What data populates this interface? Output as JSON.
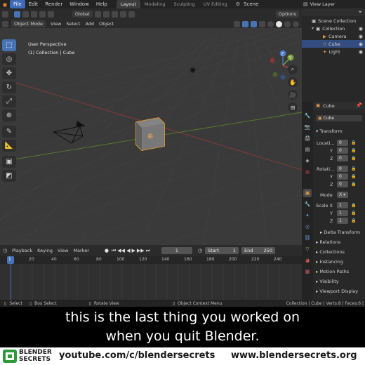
{
  "topbar": {
    "menu": [
      "File",
      "Edit",
      "Render",
      "Window",
      "Help"
    ],
    "workspaces": [
      "Layout",
      "Modeling",
      "Sculpting",
      "UV Editing"
    ],
    "scene_label": "Scene",
    "view_layer_label": "View Layer"
  },
  "viewport": {
    "header": {
      "orientation": "Global",
      "options": "Options",
      "mode": "Object Mode",
      "menus": [
        "View",
        "Select",
        "Add",
        "Object"
      ]
    },
    "perspective_label": "User Perspective",
    "collection_label": "(1) Collection | Cube",
    "gizmo": {
      "x": "X",
      "y": "Y",
      "z": "Z"
    }
  },
  "outliner": {
    "scene_collection": "Scene Collection",
    "collection": "Collection",
    "items": [
      "Camera",
      "Cube",
      "Light"
    ],
    "selected": "Cube"
  },
  "properties": {
    "object_name": "Cube",
    "object_name_field": "Cube",
    "transform_label": "Transform",
    "location_label": "Locati...",
    "location": [
      "0",
      "0",
      "0"
    ],
    "rotation_label": "Rotati...",
    "rotation": [
      "0",
      "0",
      "0"
    ],
    "mode_label": "Mode",
    "mode_value": "X",
    "scale_label": "Scale X",
    "scale": [
      "1",
      "1",
      "1"
    ],
    "axis_y": "Y",
    "axis_z": "Z",
    "sections": [
      "Delta Transform",
      "Relations",
      "Collections",
      "Instancing",
      "Motion Paths",
      "Visibility",
      "Viewport Display"
    ]
  },
  "timeline": {
    "menus": [
      "Playback",
      "Keying",
      "View",
      "Marker"
    ],
    "current_frame": "1",
    "start_label": "Start",
    "start_value": "1",
    "end_label": "End",
    "end_value": "250",
    "ticks": [
      "1",
      "20",
      "40",
      "60",
      "80",
      "100",
      "120",
      "140",
      "160",
      "180",
      "200",
      "220",
      "240"
    ]
  },
  "statusbar": {
    "select": "Select",
    "box_select": "Box Select",
    "rotate_view": "Rotate View",
    "context_menu": "Object Context Menu",
    "stats": "Collection | Cube | Verts:8 | Faces:6 |"
  },
  "caption": {
    "line1": "this is the last thing you worked on",
    "line2": "when you quit Blender."
  },
  "footer": {
    "logo_line1": "BLENDER",
    "logo_line2": "SECRETS",
    "youtube": "youtube.com/c/blendersecrets",
    "website": "www.blendersecrets.org"
  },
  "colors": {
    "accent_blue": "#4772b3",
    "selection_orange": "#f0a030",
    "x_axis_red": "#c8403e",
    "y_axis_green": "#7aa43a",
    "logo_green": "#2e9a3a"
  }
}
